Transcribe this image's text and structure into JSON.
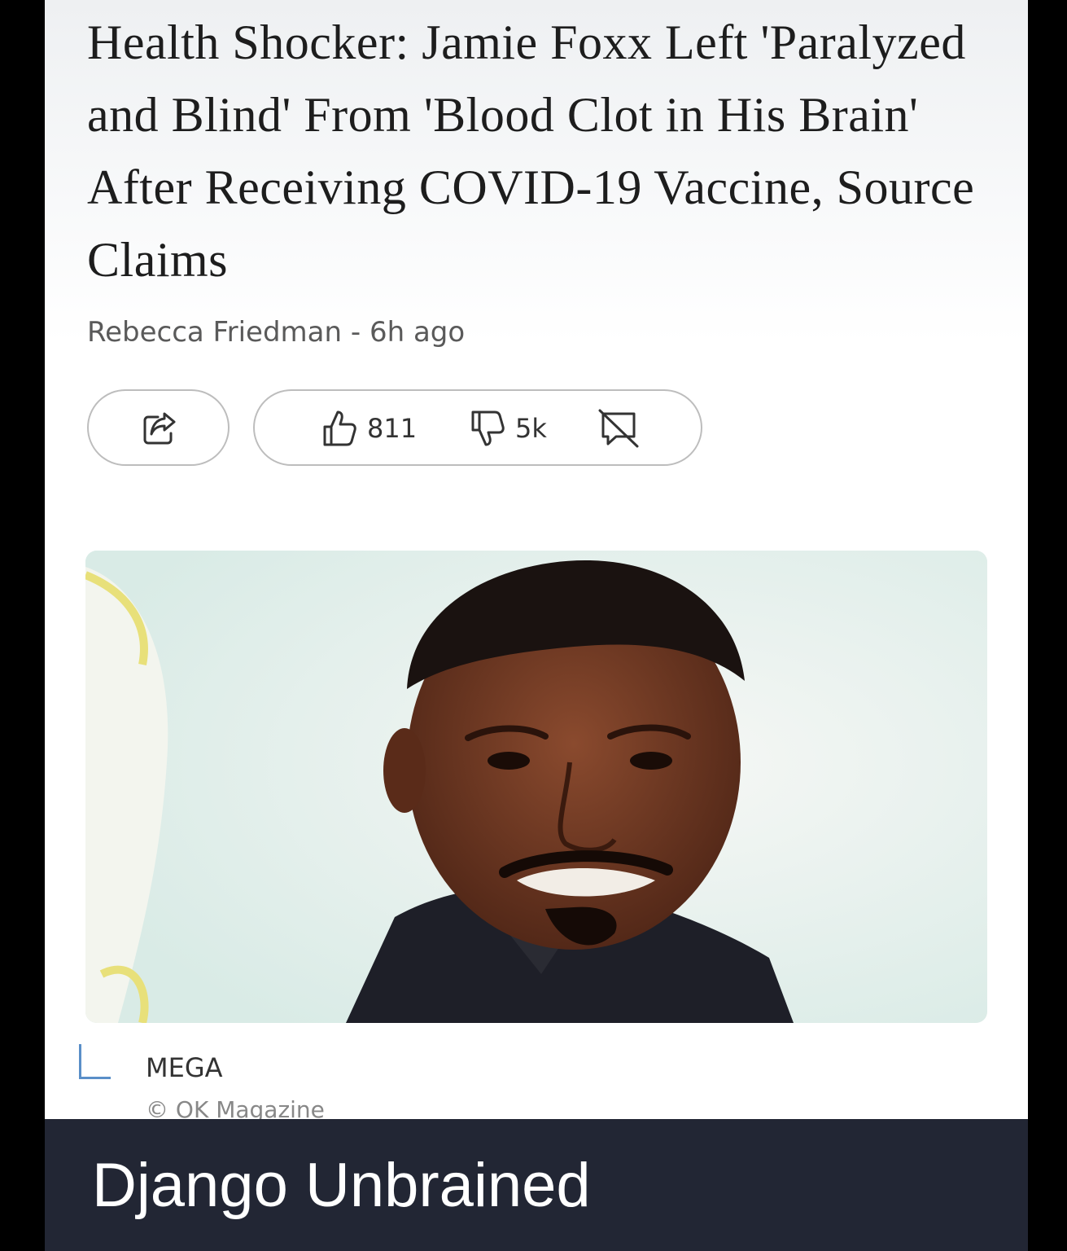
{
  "article": {
    "headline": "Health Shocker: Jamie Foxx Left 'Paralyzed and Blind' From 'Blood Clot in His Brain' After Receiving COVID-19 Vaccine, Source Claims",
    "author": "Rebecca Friedman",
    "separator": "-",
    "time_ago": "6h ago"
  },
  "actions": {
    "share_icon": "share-icon",
    "like_icon": "thumbs-up-icon",
    "like_count": "811",
    "dislike_icon": "thumbs-down-icon",
    "dislike_count": "5k",
    "comment_icon": "comment-off-icon"
  },
  "image": {
    "credit": "MEGA",
    "source": "© OK Magazine"
  },
  "meme": {
    "caption": "Django Unbrained"
  },
  "colors": {
    "caption_background": "#222634",
    "credit_accent": "#5a8fc8"
  }
}
